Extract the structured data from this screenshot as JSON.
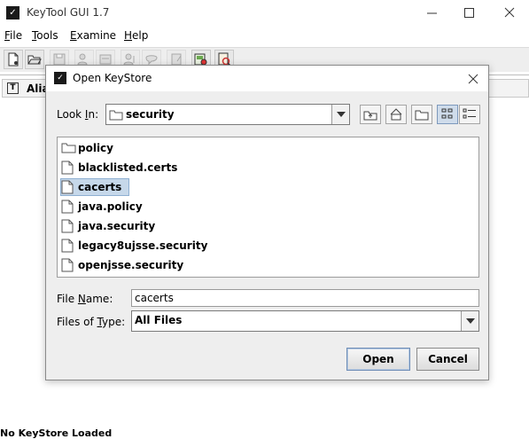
{
  "app": {
    "title": "KeyTool GUI 1.7",
    "icon": "app-logo-icon"
  },
  "window_controls": [
    "minimize-icon",
    "maximize-icon",
    "close-icon"
  ],
  "menubar": {
    "items": [
      {
        "pre": "",
        "key": "F",
        "post": "ile"
      },
      {
        "pre": "",
        "key": "T",
        "post": "ools"
      },
      {
        "pre": "",
        "key": "E",
        "post": "xamine"
      },
      {
        "pre": "",
        "key": "H",
        "post": "elp"
      }
    ]
  },
  "toolbar": {
    "buttons": [
      {
        "icon": "new-keystore-icon",
        "enabled": true
      },
      {
        "icon": "open-keystore-icon",
        "enabled": true
      },
      {
        "icon": "save-keystore-icon",
        "enabled": false
      },
      {
        "icon": "generate-keypair-icon",
        "enabled": false
      },
      {
        "icon": "import-certificate-icon",
        "enabled": false
      },
      {
        "icon": "import-keypair-icon",
        "enabled": false
      },
      {
        "icon": "set-password-icon",
        "enabled": false
      },
      {
        "icon": "keystore-report-icon",
        "enabled": false
      },
      {
        "icon": "examine-certificate-icon",
        "enabled": true
      },
      {
        "icon": "examine-file-icon",
        "enabled": true
      }
    ]
  },
  "table": {
    "header_icon_letter": "T",
    "column": "Alia"
  },
  "status": "No KeyStore Loaded",
  "dialog": {
    "title": "Open KeyStore",
    "look_in": {
      "pre": "Look ",
      "key": "I",
      "post": "n:",
      "value": "security"
    },
    "nav_buttons": [
      "up-one-level-icon",
      "home-icon",
      "new-folder-icon",
      "list-view-icon",
      "details-view-icon"
    ],
    "files": [
      {
        "name": "policy",
        "type": "folder",
        "selected": false
      },
      {
        "name": "blacklisted.certs",
        "type": "file",
        "selected": false
      },
      {
        "name": "cacerts",
        "type": "file",
        "selected": true
      },
      {
        "name": "java.policy",
        "type": "file",
        "selected": false
      },
      {
        "name": "java.security",
        "type": "file",
        "selected": false
      },
      {
        "name": "legacy8ujsse.security",
        "type": "file",
        "selected": false
      },
      {
        "name": "openjsse.security",
        "type": "file",
        "selected": false
      }
    ],
    "file_name": {
      "pre": "File ",
      "key": "N",
      "post": "ame:",
      "value": "cacerts"
    },
    "file_type": {
      "pre": "Files of ",
      "key": "T",
      "post": "ype:",
      "value": "All Files"
    },
    "open_label": "Open",
    "cancel_label": "Cancel"
  },
  "colors": {
    "selection": "#c6d8ea",
    "dialog_bg": "#eeeeee"
  }
}
